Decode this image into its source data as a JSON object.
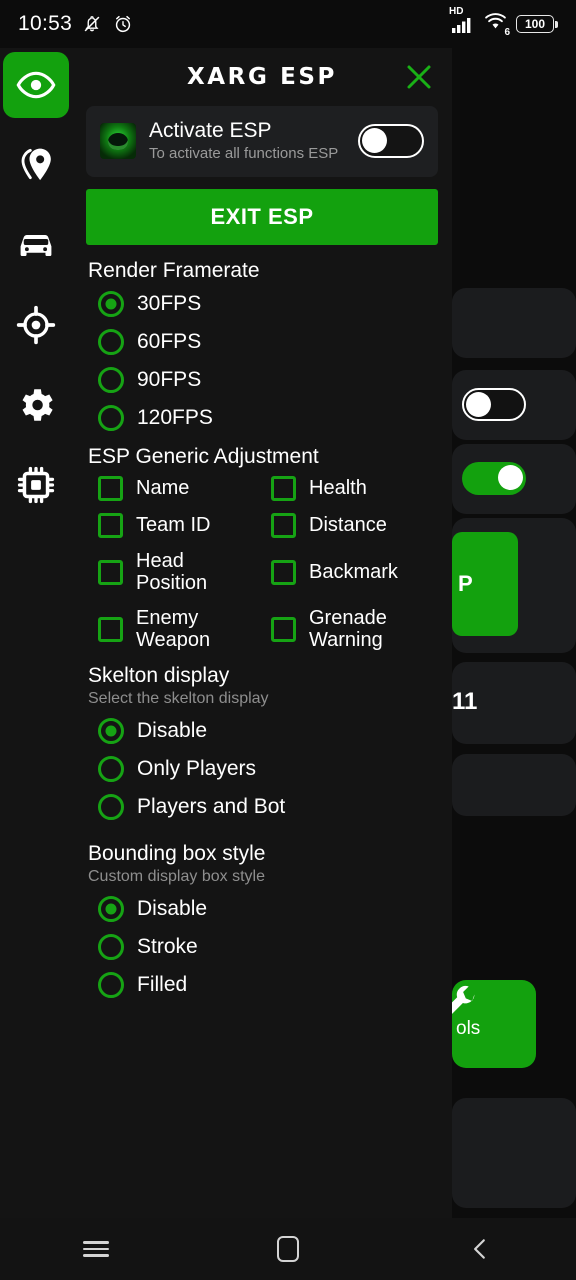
{
  "colors": {
    "accent_green": "#13a10e",
    "radio_green": "#16a314",
    "panel_bg": "#141414",
    "card_bg": "#1e1f21",
    "screen_bg": "#0c0c0c",
    "text_primary": "#ffffff",
    "text_secondary": "#9a9a9a"
  },
  "status_bar": {
    "time": "10:53",
    "icons_left": [
      "bell-muted-icon",
      "alarm-clock-icon"
    ],
    "network_label": "HD",
    "wifi_generation": "6",
    "battery_level": "100",
    "icons_right": [
      "hd-signal-icon",
      "wifi-6-icon",
      "battery-icon"
    ]
  },
  "sidebar": {
    "items": [
      {
        "name": "sidebar-item-esp",
        "icon": "eye-icon",
        "active": true
      },
      {
        "name": "sidebar-item-location",
        "icon": "location-pin-icon",
        "active": false
      },
      {
        "name": "sidebar-item-vehicle",
        "icon": "car-icon",
        "active": false
      },
      {
        "name": "sidebar-item-aim",
        "icon": "crosshair-target-icon",
        "active": false
      },
      {
        "name": "sidebar-item-settings",
        "icon": "gear-icon",
        "active": false
      },
      {
        "name": "sidebar-item-memory",
        "icon": "cpu-chip-icon",
        "active": false
      }
    ]
  },
  "overlay": {
    "title": "XARG ESP",
    "close_icon": "close-x-icon",
    "activate_card": {
      "logo_icon": "app-logo-icon",
      "title": "Activate ESP",
      "subtitle": "To activate all functions ESP",
      "toggle_state": "off"
    },
    "exit_button": "EXIT ESP",
    "sections": [
      {
        "key": "render_framerate",
        "title": "Render Framerate",
        "subtitle": "",
        "type": "radio",
        "options": [
          {
            "label": "30FPS",
            "selected": true
          },
          {
            "label": "60FPS",
            "selected": false
          },
          {
            "label": "90FPS",
            "selected": false
          },
          {
            "label": "120FPS",
            "selected": false
          }
        ]
      },
      {
        "key": "esp_generic_adjustment",
        "title": "ESP Generic Adjustment",
        "subtitle": "",
        "type": "checkbox-grid",
        "options": [
          {
            "label": "Name",
            "checked": false
          },
          {
            "label": "Health",
            "checked": false
          },
          {
            "label": "Team ID",
            "checked": false
          },
          {
            "label": "Distance",
            "checked": false
          },
          {
            "label": "Head Position",
            "checked": false
          },
          {
            "label": "Backmark",
            "checked": false
          },
          {
            "label": "Enemy Weapon",
            "checked": false
          },
          {
            "label": "Grenade Warning",
            "checked": false
          }
        ]
      },
      {
        "key": "skelton_display",
        "title": "Skelton display",
        "subtitle": "Select the skelton display",
        "type": "radio",
        "options": [
          {
            "label": "Disable",
            "selected": true
          },
          {
            "label": "Only Players",
            "selected": false
          },
          {
            "label": "Players and Bot",
            "selected": false
          }
        ]
      },
      {
        "key": "bounding_box_style",
        "title": "Bounding box style",
        "subtitle": "Custom display box style",
        "type": "radio",
        "options": [
          {
            "label": "Disable",
            "selected": true
          },
          {
            "label": "Stroke",
            "selected": false
          },
          {
            "label": "Filled",
            "selected": false
          }
        ]
      }
    ]
  },
  "background_app": {
    "visible_fragments": [
      {
        "name": "bg-toggle-off",
        "type": "toggle",
        "state": "off"
      },
      {
        "name": "bg-toggle-on",
        "type": "toggle",
        "state": "on"
      },
      {
        "name": "bg-green-button-fragment",
        "type": "button",
        "text": "P"
      },
      {
        "name": "bg-count-text",
        "type": "text",
        "text": "11"
      },
      {
        "name": "bg-tools-card",
        "type": "card",
        "text": "ols",
        "icon": "wrench-tool-icon"
      }
    ]
  },
  "nav_bar": {
    "buttons": [
      {
        "name": "nav-recents-button",
        "icon": "hamburger-icon"
      },
      {
        "name": "nav-home-button",
        "icon": "home-square-icon"
      },
      {
        "name": "nav-back-button",
        "icon": "chevron-left-icon"
      }
    ]
  }
}
